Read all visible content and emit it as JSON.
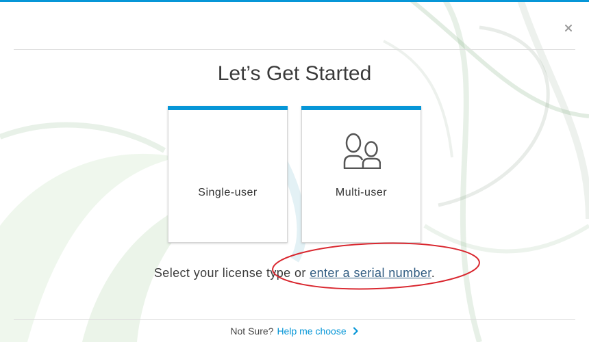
{
  "theme": {
    "accent": "#0696d7",
    "link": "#2e5a80",
    "annotation": "#d9262e"
  },
  "header": {
    "close_icon": "close-icon"
  },
  "title": "Let’s Get Started",
  "license_options": [
    {
      "label": "Single-user"
    },
    {
      "label": "Multi-user",
      "icon": "multi-user-icon"
    }
  ],
  "instruction": {
    "text": "Select your license type or ",
    "link": "enter a serial number",
    "end": "."
  },
  "annotation": {
    "shape": "ellipse",
    "color": "#d9262e"
  },
  "footer": {
    "question": "Not Sure?",
    "link": "Help me choose",
    "icon": "chevron-right-icon"
  }
}
